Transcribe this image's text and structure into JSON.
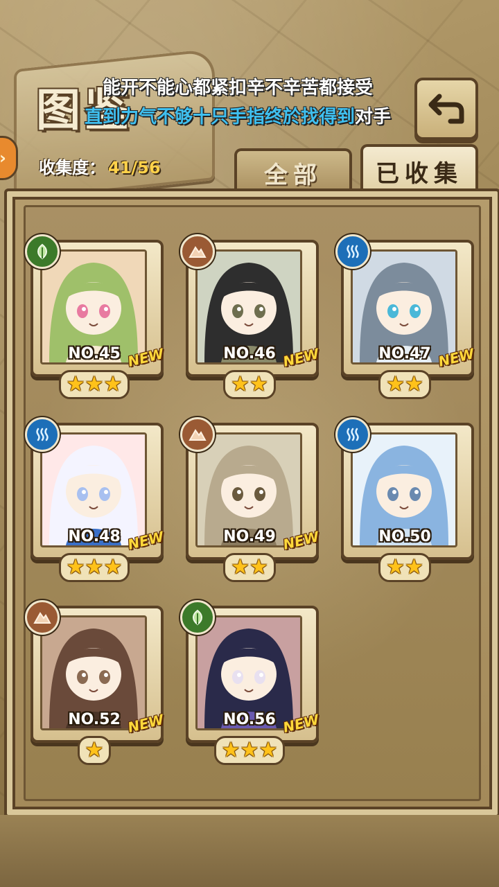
{
  "header": {
    "title": "图鉴",
    "lyric_line1": "能开不能心都紧扣辛不辛苦都接受",
    "lyric_line2_blue": "直到力气不够十只手指终於找得到",
    "lyric_line2_white": "对手",
    "collection_label": "收集度：",
    "collection_value": "41/56"
  },
  "tabs": {
    "all": "全部",
    "collected": "已收集"
  },
  "cards": [
    {
      "no": "NO.45",
      "new": "NEW",
      "stars": "★★★",
      "element": "wood",
      "palette": [
        "#9fc06a",
        "#f6ead2",
        "#e87aa0",
        "#f0d8b8"
      ]
    },
    {
      "no": "NO.46",
      "new": "NEW",
      "stars": "★★",
      "element": "earth",
      "palette": [
        "#2e2e2e",
        "#8a8a6a",
        "#6e6e4e",
        "#cfd4c2"
      ]
    },
    {
      "no": "NO.47",
      "new": "NEW",
      "stars": "★★",
      "element": "water",
      "palette": [
        "#7c8c9c",
        "#e6eef4",
        "#4ab8d8",
        "#d0dae4"
      ]
    },
    {
      "no": "NO.48",
      "new": "NEW",
      "stars": "★★★",
      "element": "water",
      "palette": [
        "#f4f4ff",
        "#3a70c8",
        "#a8c0f0",
        "#ffe8e8"
      ]
    },
    {
      "no": "NO.49",
      "new": "NEW",
      "stars": "★★",
      "element": "earth",
      "palette": [
        "#b8aa8e",
        "#8a7a5e",
        "#6a5a3e",
        "#d8d0b8"
      ]
    },
    {
      "no": "NO.50",
      "new": "",
      "stars": "★★",
      "element": "water",
      "palette": [
        "#8ab4e0",
        "#cfe2f2",
        "#6a8ab0",
        "#e8f2fa"
      ]
    },
    {
      "no": "NO.52",
      "new": "NEW",
      "stars": "★",
      "element": "earth",
      "palette": [
        "#6a4a3a",
        "#4a3428",
        "#8a6a52",
        "#c8a890"
      ]
    },
    {
      "no": "NO.56",
      "new": "NEW",
      "stars": "★★★",
      "element": "wood",
      "palette": [
        "#2a2a4a",
        "#6a5ab0",
        "#e8e0f0",
        "#c8a0a0"
      ]
    }
  ]
}
